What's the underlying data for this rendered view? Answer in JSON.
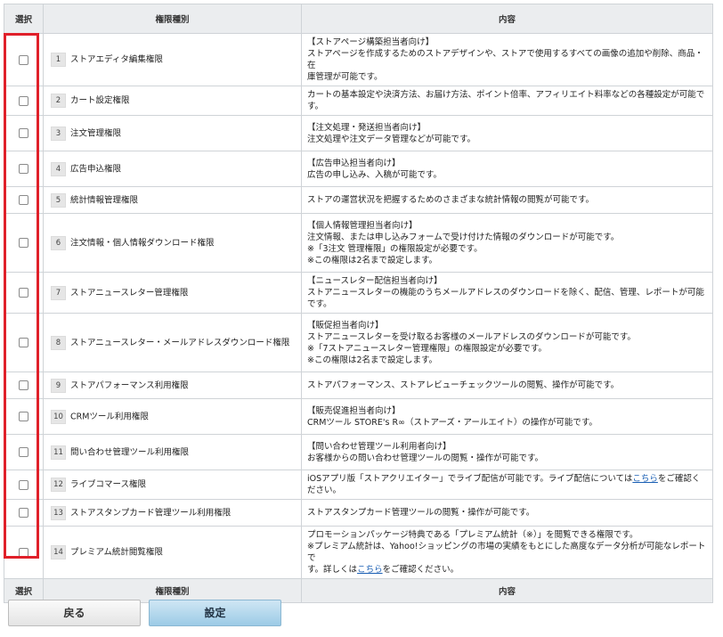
{
  "header": {
    "select": "選択",
    "type": "権限種別",
    "content": "内容"
  },
  "rows": [
    {
      "num": "1",
      "name": "ストアエディタ編集権限",
      "desc": [
        "【ストアページ構築担当者向け】",
        "ストアページを作成するためのストアデザインや、ストアで使用するすべての画像の追加や削除、商品・在",
        "庫管理が可能です。"
      ]
    },
    {
      "num": "2",
      "name": "カート設定権限",
      "desc": [
        "カートの基本設定や決済方法、お届け方法、ポイント倍率、アフィリエイト料率などの各種設定が可能です。"
      ]
    },
    {
      "num": "3",
      "name": "注文管理権限",
      "desc": [
        "【注文処理・発送担当者向け】",
        "注文処理や注文データ管理などが可能です。"
      ]
    },
    {
      "num": "4",
      "name": "広告申込権限",
      "desc": [
        "【広告申込担当者向け】",
        "広告の申し込み、入稿が可能です。"
      ]
    },
    {
      "num": "5",
      "name": "統計情報管理権限",
      "desc": [
        "ストアの運営状況を把握するためのさまざまな統計情報の閲覧が可能です。"
      ]
    },
    {
      "num": "6",
      "name": "注文情報・個人情報ダウンロード権限",
      "desc": [
        "【個人情報管理担当者向け】",
        "注文情報、または申し込みフォームで受け付けた情報のダウンロードが可能です。",
        "※「3注文 管理権限」の権限設定が必要です。",
        "※この権限は2名まで設定します。"
      ]
    },
    {
      "num": "7",
      "name": "ストアニュースレター管理権限",
      "desc": [
        "【ニュースレター配信担当者向け】",
        "ストアニュースレターの機能のうちメールアドレスのダウンロードを除く、配信、管理、レポートが可能です。"
      ]
    },
    {
      "num": "8",
      "name": "ストアニュースレター・メールアドレスダウンロード権限",
      "desc": [
        "【販促担当者向け】",
        "ストアニュースレターを受け取るお客様のメールアドレスのダウンロードが可能です。",
        "※「7ストアニュースレター管理権限」の権限設定が必要です。",
        "※この権限は2名まで設定します。"
      ]
    },
    {
      "num": "9",
      "name": "ストアパフォーマンス利用権限",
      "desc": [
        "ストアパフォーマンス、ストアレビューチェックツールの閲覧、操作が可能です。"
      ]
    },
    {
      "num": "10",
      "name": "CRMツール利用権限",
      "desc": [
        "【販売促進担当者向け】",
        "CRMツール STORE's R∞（ストアーズ・アールエイト）の操作が可能です。"
      ]
    },
    {
      "num": "11",
      "name": "問い合わせ管理ツール利用権限",
      "desc": [
        "【問い合わせ管理ツール利用者向け】",
        "お客様からの問い合わせ管理ツールの閲覧・操作が可能です。"
      ]
    },
    {
      "num": "12",
      "name": "ライブコマース権限",
      "desc": [
        "iOSアプリ版「ストアクリエイター」でライブ配信が可能です。ライブ配信については"
      ],
      "link": "こちら",
      "after_link": "をご確認ください。"
    },
    {
      "num": "13",
      "name": "ストアスタンプカード管理ツール利用権限",
      "desc": [
        "ストアスタンプカード管理ツールの閲覧・操作が可能です。"
      ]
    },
    {
      "num": "14",
      "name": "プレミアム統計閲覧権限",
      "desc": [
        "プロモーションパッケージ特典である「プレミアム統計（※）」を閲覧できる権限です。",
        "※プレミアム統計は、Yahoo!ショッピングの市場の実績をもとにした高度なデータ分析が可能なレポートで",
        "す。詳しくは"
      ],
      "link": "こちら",
      "after_link": "をご確認ください。"
    }
  ],
  "buttons": {
    "back": "戻る",
    "set": "設定"
  },
  "colors": {
    "highlight": "#e0202a",
    "header_bg": "#ebedef",
    "primary_button": "#9ccbe6"
  }
}
